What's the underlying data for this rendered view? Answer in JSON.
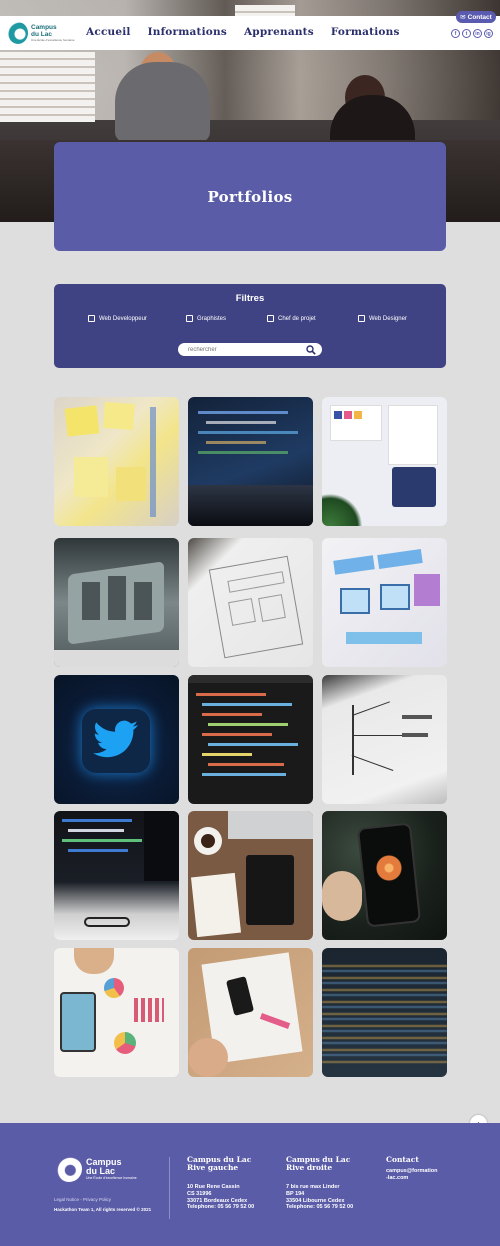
{
  "header": {
    "logo": {
      "name": "Campus du Lac",
      "line1": "Campus",
      "line2": "du Lac",
      "tagline": "Une École d'excellence humaine"
    },
    "nav": [
      "Accueil",
      "Informations",
      "Apprenants",
      "Formations"
    ],
    "contact_label": "Contact",
    "socials": [
      "f",
      "t",
      "in",
      "ig"
    ]
  },
  "hero": {
    "title": "Portfolios"
  },
  "filters": {
    "title": "Filtres",
    "options": [
      "Web Developpeur",
      "Graphistes",
      "Chef de projet",
      "Web Designer"
    ],
    "search_placeholder": "rechercher"
  },
  "portfolio_tiles": [
    {
      "subject": "sticky-notes-board",
      "colors": [
        "#f1e7a6",
        "#e4d8cf"
      ]
    },
    {
      "subject": "laptop-code-blue",
      "colors": [
        "#1b2b44",
        "#3f6fa0"
      ]
    },
    {
      "subject": "ui-design-palette",
      "colors": [
        "#e9eaf0",
        "#3a56a8"
      ]
    },
    {
      "subject": "3d-letters-monitor",
      "colors": [
        "#6f7d7e",
        "#2e3a3c"
      ]
    },
    {
      "subject": "wireframe-sketch",
      "colors": [
        "#eeeeee",
        "#c5c1bb"
      ]
    },
    {
      "subject": "colored-wireframe",
      "colors": [
        "#ecebf2",
        "#4b87c8"
      ]
    },
    {
      "subject": "twitter-icon",
      "colors": [
        "#0c1f3a",
        "#1c9cf0"
      ]
    },
    {
      "subject": "code-editor",
      "colors": [
        "#1c1c1c",
        "#c25a44"
      ]
    },
    {
      "subject": "mind-map-screen",
      "colors": [
        "#e8e8e8",
        "#3b3b3b"
      ]
    },
    {
      "subject": "dark-desk-code",
      "colors": [
        "#121418",
        "#3b74b7"
      ]
    },
    {
      "subject": "desk-coffee-tablet",
      "colors": [
        "#7a5b43",
        "#f1ede7"
      ]
    },
    {
      "subject": "phone-flower",
      "colors": [
        "#1d2620",
        "#e88a45"
      ]
    },
    {
      "subject": "charts-paper",
      "colors": [
        "#f2f0ee",
        "#d24f6a"
      ]
    },
    {
      "subject": "phone-sketch-desk",
      "colors": [
        "#c8a07a",
        "#f0eeea"
      ]
    },
    {
      "subject": "blurred-code",
      "colors": [
        "#1b2430",
        "#d4a84a"
      ]
    }
  ],
  "footer": {
    "logo_line1": "Campus",
    "logo_line2": "du Lac",
    "logo_tagline": "Une École d'excellence humaine",
    "legal": "Legal Notice - Privacy Policy",
    "copyright": "Hackathon Team 1, All rights reserved © 2021",
    "col1": {
      "title_line1": "Campus du Lac",
      "title_line2": "Rive gauche",
      "lines": [
        "10 Rue Rene Cassin",
        "CS 31996",
        "33071 Bordeaux Cedex",
        "Telephone: 05 56 79 52 00"
      ]
    },
    "col2": {
      "title_line1": "Campus du Lac",
      "title_line2": "Rive droite",
      "lines": [
        "7 bis rue max Linder",
        "BP 194",
        "33504 Libourne Cedex",
        "Telephone: 05 56 79 52 00"
      ]
    },
    "col3": {
      "title": "Contact",
      "lines": [
        "campus@formation",
        "-lac.com"
      ]
    }
  },
  "colors": {
    "primary": "#5b5ca8",
    "filters_bg": "#404383",
    "nav_text": "#2b2f6b",
    "page_bg": "#dedede"
  }
}
